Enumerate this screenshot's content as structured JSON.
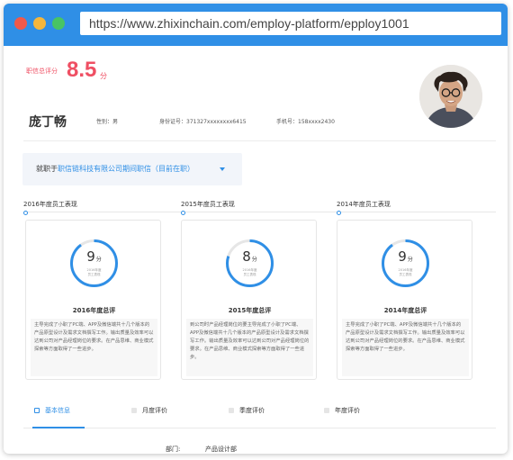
{
  "browser": {
    "url": "https://www.zhixinchain.com/employ-platform/epploy1001"
  },
  "profile": {
    "score_label": "职信总评分",
    "score_value": "8.5",
    "score_unit": "分",
    "name": "庞丁畅",
    "gender": "性别：男",
    "id_number": "身份证号：371327xxxxxxxx6415",
    "phone": "手机号：158xxxx2430",
    "avatar_icon": "profile-photo"
  },
  "employment": {
    "prefix": "就职于",
    "company": "职信链科技有限公司期间职信（目前在职）"
  },
  "years": [
    {
      "header": "2016年度员工表现",
      "score": "9",
      "unit": "分",
      "ring_fraction": 0.9,
      "ring_sub_1": "2016年度",
      "ring_sub_2": "员工表现",
      "title": "2016年度总评",
      "text": "主导完成了小职了PC端、APP及微信端共十几个版本的产品原型设计及需求文档撰写工作。输出质量及效率可以达到公司对产品经理岗位的要求。在产品思维、商业模式探索等方面取得了一些进步。"
    },
    {
      "header": "2015年度员工表现",
      "score": "8",
      "unit": "分",
      "ring_fraction": 0.8,
      "ring_sub_1": "2016年度",
      "ring_sub_2": "员工表现",
      "title": "2015年度总评",
      "text": "到公司时产品经理岗位的要主导完成了小职了PC端、APP及微信端共十几个版本的产品原型设计及需求文档撰写工作。输出质量及效率可以达到公司对产品经理岗位的要求。在产品思维、商业模式探索等方面取得了一些进步。"
    },
    {
      "header": "2014年度员工表现",
      "score": "9",
      "unit": "分",
      "ring_fraction": 0.9,
      "ring_sub_1": "2016年度",
      "ring_sub_2": "员工表现",
      "title": "2014年度总评",
      "text": "主导完成了小职了PC端、APP及微信端共十几个版本的产品原型设计及需求文档撰写工作。输出质量及效率可以达到公司对产品经理岗位的要求。在产品思维、商业模式探索等方面取得了一些进步。"
    }
  ],
  "tabs": [
    {
      "label": "基本信息",
      "icon": "document-icon"
    },
    {
      "label": "月度评价",
      "icon": "calendar-icon"
    },
    {
      "label": "季度评价",
      "icon": "calendar-icon"
    },
    {
      "label": "年度评价",
      "icon": "calendar-icon"
    }
  ],
  "basic_info": {
    "dept_label": "部门:",
    "dept_value": "产品设计部"
  },
  "colors": {
    "accent": "#2f8fe6",
    "score": "#ef4f63",
    "titlebar": "#2f8fe6"
  }
}
